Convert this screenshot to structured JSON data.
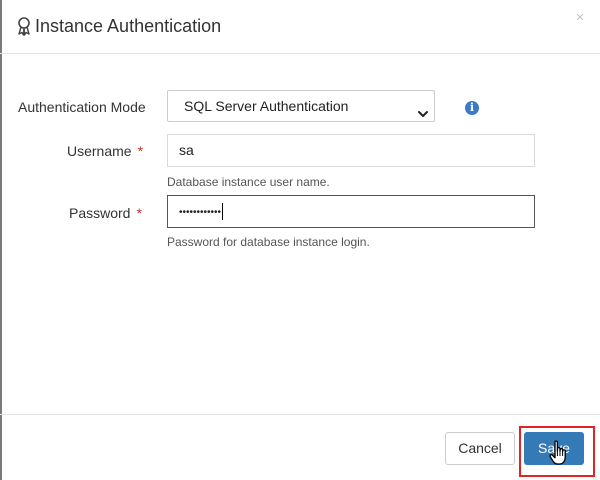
{
  "dialog": {
    "title": "Instance Authentication",
    "close_glyph": "×"
  },
  "form": {
    "auth_mode": {
      "label": "Authentication Mode",
      "selected": "SQL Server Authentication"
    },
    "username": {
      "label": "Username",
      "required_mark": "*",
      "value": "sa",
      "help": "Database instance user name."
    },
    "password": {
      "label": "Password",
      "required_mark": "*",
      "value_masked": "••••••••••••",
      "help": "Password for database instance login."
    }
  },
  "footer": {
    "cancel_label": "Cancel",
    "save_label": "Save"
  },
  "icons": {
    "title": "award-icon",
    "info": "info-icon",
    "info_glyph": "i",
    "close": "close-icon",
    "dropdown": "chevron-down-icon",
    "cursor": "hand-pointer-icon"
  },
  "colors": {
    "primary": "#337ab7",
    "required": "#c9302c",
    "info": "#3a7ac7",
    "highlight": "#e02424"
  }
}
